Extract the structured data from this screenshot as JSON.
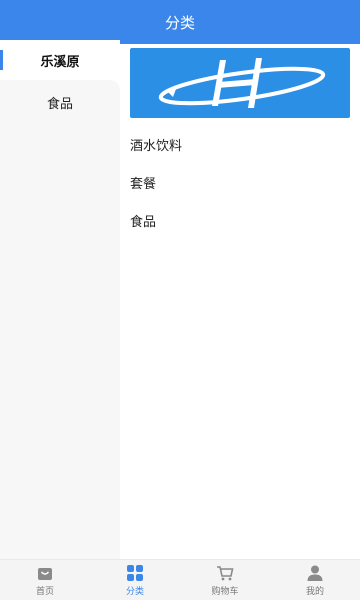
{
  "header": {
    "title": "分类"
  },
  "sidebar": {
    "items": [
      {
        "label": "乐溪原",
        "active": true
      },
      {
        "label": "食品",
        "active": false
      }
    ]
  },
  "content": {
    "banner_logo": "H-logo",
    "categories": [
      {
        "label": "酒水饮料"
      },
      {
        "label": "套餐"
      },
      {
        "label": "食品"
      }
    ]
  },
  "tabbar": {
    "tabs": [
      {
        "label": "首页",
        "icon": "shopping-bag-icon"
      },
      {
        "label": "分类",
        "icon": "grid-icon",
        "active": true
      },
      {
        "label": "购物车",
        "icon": "cart-icon"
      },
      {
        "label": "我的",
        "icon": "user-icon"
      }
    ]
  },
  "colors": {
    "accent": "#3b86ea",
    "banner": "#2c8fe6",
    "sidebar_bg": "#f7f7f7"
  }
}
